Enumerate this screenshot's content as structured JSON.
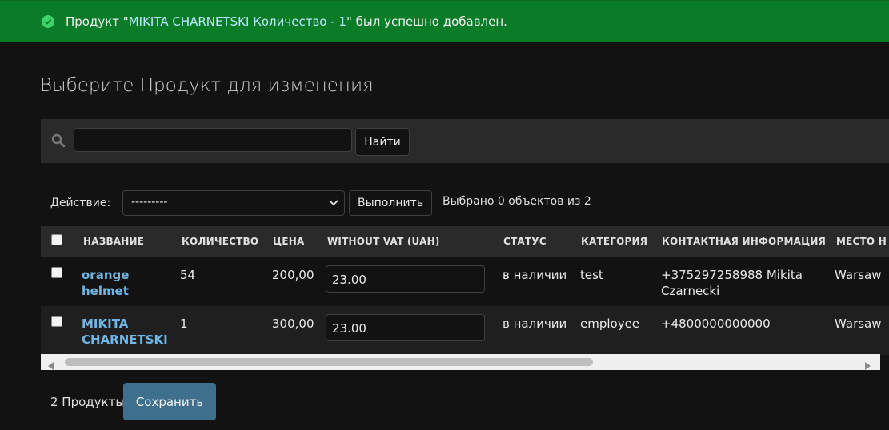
{
  "message": {
    "prefix": "Продукт \"",
    "link": "MIKITA CHARNETSKI Количество - 1",
    "suffix": "\" был успешно добавлен."
  },
  "page_title": "Выберите Продукт для изменения",
  "search": {
    "value": "",
    "button_label": "Найти"
  },
  "actions": {
    "label": "Действие:",
    "selected": "---------",
    "run_label": "Выполнить",
    "counter": "Выбрано 0 объектов из 2"
  },
  "table": {
    "headers": [
      "НАЗВАНИЕ",
      "КОЛИЧЕСТВО",
      "ЦЕНА",
      "WITHOUT VAT (UAH)",
      "СТАТУС",
      "КАТЕГОРИЯ",
      "КОНТАКТНАЯ ИНФОРМАЦИЯ",
      "МЕСТО Н"
    ],
    "rows": [
      {
        "name_line1": "orange",
        "name_line2": "helmet",
        "quantity": "54",
        "price": "200,00",
        "without_vat": "23.00",
        "status": "в наличии",
        "category": "test",
        "contact_line1": "+375297258988 Mikita",
        "contact_line2": "Czarnecki",
        "place": "Warsaw"
      },
      {
        "name_line1": "MIKITA",
        "name_line2": "CHARNETSKI",
        "quantity": "1",
        "price": "300,00",
        "without_vat": "23.00",
        "status": "в наличии",
        "category": "employee",
        "contact_line1": "+4800000000000",
        "contact_line2": "",
        "place": "Warsaw"
      }
    ]
  },
  "footer": {
    "count": "2 Продукты",
    "save_label": "Сохранить"
  },
  "colors": {
    "success": "#0a7c27",
    "link": "#6fb6e6",
    "save": "#3e6f8c"
  }
}
